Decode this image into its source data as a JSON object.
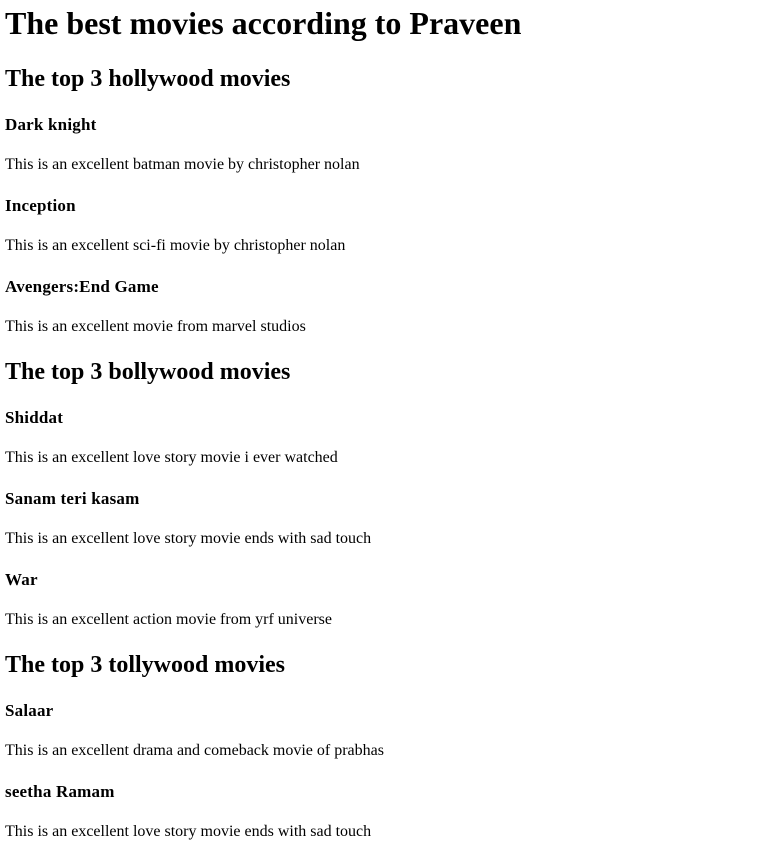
{
  "page": {
    "title": "The best movies according to Praveen"
  },
  "sections": [
    {
      "heading": "The top 3 hollywood movies",
      "movies": [
        {
          "title": "Dark knight",
          "description": "This is an excellent batman movie by christopher nolan"
        },
        {
          "title": "Inception",
          "description": "This is an excellent sci-fi movie by christopher nolan"
        },
        {
          "title": "Avengers:End Game",
          "description": "This is an excellent movie from marvel studios"
        }
      ]
    },
    {
      "heading": "The top 3 bollywood movies",
      "movies": [
        {
          "title": "Shiddat",
          "description": "This is an excellent love story movie i ever watched"
        },
        {
          "title": "Sanam teri kasam",
          "description": "This is an excellent love story movie ends with sad touch"
        },
        {
          "title": "War",
          "description": "This is an excellent action movie from yrf universe"
        }
      ]
    },
    {
      "heading": "The top 3 tollywood movies",
      "movies": [
        {
          "title": "Salaar",
          "description": "This is an excellent drama and comeback movie of prabhas"
        },
        {
          "title": "seetha Ramam",
          "description": "This is an excellent love story movie ends with sad touch"
        }
      ]
    }
  ]
}
